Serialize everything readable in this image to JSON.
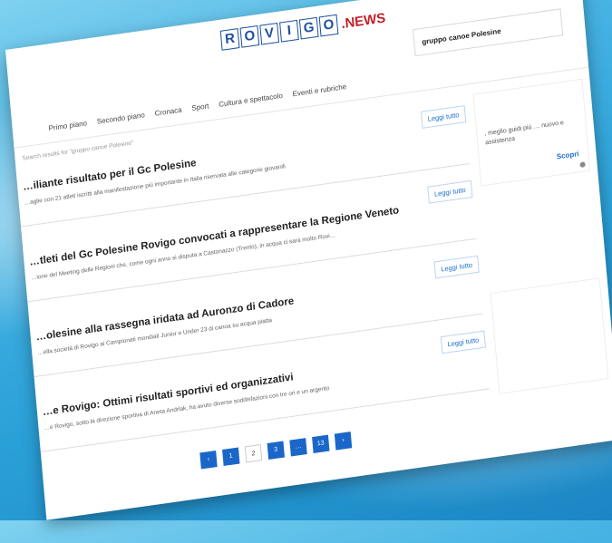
{
  "brand": {
    "letters": [
      "R",
      "O",
      "V",
      "I",
      "G",
      "O"
    ],
    "suffix": ".NEWS",
    "primary_color": "#1d4f9c",
    "accent_color": "#c41f2a"
  },
  "search": {
    "value": "gruppo canoe Polesine"
  },
  "nav": {
    "items": [
      "Primo piano",
      "Secondo piano",
      "Cronaca",
      "Sport",
      "Cultura e spettacolo",
      "Eventi e rubriche"
    ]
  },
  "breadcrumb": "Search results for \"gruppo canoe Polesine\"",
  "results": [
    {
      "title": "…iliante risultato per il Gc Polesine",
      "excerpt": "…aglie con 21 atleti iscritti alla manifestazione più importante in Italia riservata alle categorie giovanili",
      "button": "Leggi tutto"
    },
    {
      "title": "…tleti del Gc Polesine Rovigo convocati a rappresentare la Regione Veneto",
      "excerpt": "…ione del Meeting delle Regioni che, come ogni anno si disputa a Castonazzo (Trento), in acqua ci sarà molto Rovi…",
      "button": "Leggi tutto"
    },
    {
      "title": "…olesine alla rassegna iridata ad Auronzo di Cadore",
      "excerpt": "…ella società di Rovigo ai Campionati mondiali Junior e Under 23 di canoa su acqua piatta",
      "button": "Leggi tutto"
    },
    {
      "title": "…e Rovigo: Ottimi risultati sportivi ed organizzativi",
      "excerpt": "…e Rovigo, sotto la direzione sportiva di Aneta Andrlak, ha avuto diverse soddisfazioni con tre ori e un argento",
      "button": "Leggi tutto"
    }
  ],
  "sidebar": {
    "text": ", meglio guidi più … nuovo e assistenza",
    "link": "Scopri"
  },
  "pagination": {
    "prev": "‹",
    "pages": [
      "1",
      "2",
      "3",
      "…",
      "13"
    ],
    "current": "2",
    "next": "›"
  }
}
